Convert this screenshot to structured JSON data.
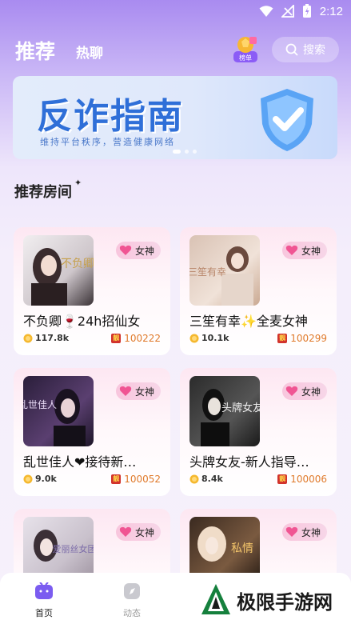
{
  "status_bar": {
    "time": "2:12"
  },
  "header": {
    "tabs": [
      {
        "label": "推荐",
        "active": true
      },
      {
        "label": "热聊",
        "active": false
      }
    ],
    "rank_badge": "榜单",
    "search_label": "搜索"
  },
  "banner": {
    "title": "反诈指南",
    "subtitle": "维持平台秩序，营造健康网络",
    "page_count": 3,
    "active_page": 1
  },
  "section": {
    "title": "推荐房间"
  },
  "rooms": [
    {
      "name": "不负卿🍷24h招仙女",
      "badge": "女神",
      "heat": "117.8k",
      "room_id": "100222",
      "cover_text": "不负卿"
    },
    {
      "name": "三笙有幸✨全麦女神",
      "badge": "女神",
      "heat": "10.1k",
      "room_id": "100299",
      "cover_text": "三笙有幸"
    },
    {
      "name": "乱世佳人❤接待新…",
      "badge": "女神",
      "heat": "9.0k",
      "room_id": "100052",
      "cover_text": "乱世佳人"
    },
    {
      "name": "头牌女友-新人指导…",
      "badge": "女神",
      "heat": "8.4k",
      "room_id": "100006",
      "cover_text": "头牌女友"
    },
    {
      "name": "",
      "badge": "女神",
      "heat": "",
      "room_id": "",
      "cover_text": "爱丽丝女团"
    },
    {
      "name": "",
      "badge": "女神",
      "heat": "",
      "room_id": "",
      "cover_text": "私情"
    }
  ],
  "room_id_badge": "靓",
  "bottom_nav": [
    {
      "label": "首页",
      "active": true
    },
    {
      "label": "动态",
      "active": false
    }
  ],
  "watermark": "极限手游网",
  "colors": {
    "accent_purple": "#a98bf0",
    "banner_blue": "#2f6fd8",
    "room_id_orange": "#e07a2c",
    "nav_active": "#7b5cf0"
  }
}
